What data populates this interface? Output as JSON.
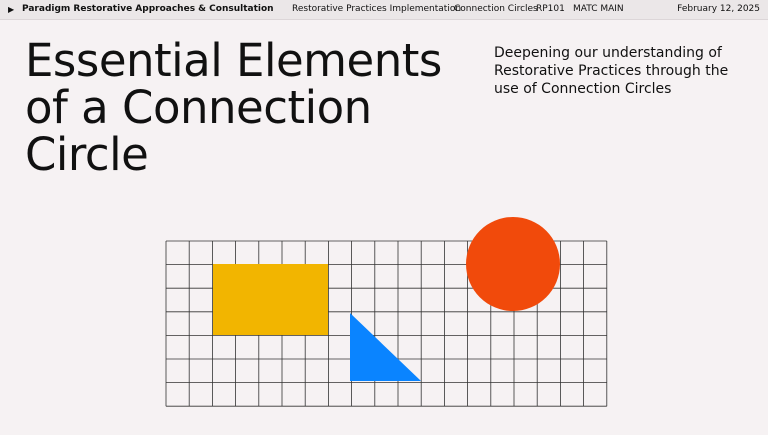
{
  "header": {
    "organization": "Paradigm Restorative Approaches & Consultation",
    "course_title": "Restorative Practices Implementation",
    "topic": "Connection Circles",
    "course_code": "RP101",
    "location": "MATC MAIN",
    "date": "February 12, 2025"
  },
  "slide": {
    "title": "Essential Elements of a Connection Circle",
    "subtitle": "Deepening our understanding of Restorative Practices through the use of Connection Circles"
  },
  "colors": {
    "background": "#f6f2f3",
    "rectangle": "#f2b500",
    "triangle": "#0a84ff",
    "circle": "#f14a0b",
    "grid_line": "#333333"
  },
  "icons": {
    "present": "play-triangle"
  }
}
